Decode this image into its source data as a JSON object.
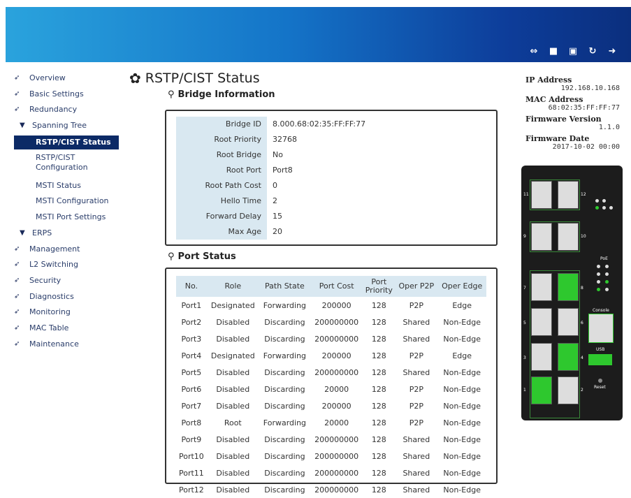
{
  "toolbar": {
    "icons": [
      "link-icon",
      "save-icon",
      "save-as-icon",
      "refresh-icon",
      "logout-icon"
    ]
  },
  "sidebar": {
    "items": [
      {
        "label": "Overview"
      },
      {
        "label": "Basic Settings"
      },
      {
        "label": "Redundancy"
      },
      {
        "label": "Spanning Tree"
      },
      {
        "label": "RSTP/CIST Status"
      },
      {
        "label": "RSTP/CIST Configuration"
      },
      {
        "label": "MSTI Status"
      },
      {
        "label": "MSTI Configuration"
      },
      {
        "label": "MSTI Port Settings"
      },
      {
        "label": "ERPS"
      },
      {
        "label": "Management"
      },
      {
        "label": "L2 Switching"
      },
      {
        "label": "Security"
      },
      {
        "label": "Diagnostics"
      },
      {
        "label": "Monitoring"
      },
      {
        "label": "MAC Table"
      },
      {
        "label": "Maintenance"
      }
    ]
  },
  "page": {
    "title": "RSTP/CIST Status"
  },
  "bridge": {
    "heading": "Bridge Information",
    "rows": [
      {
        "label": "Bridge ID",
        "value": "8.000.68:02:35:FF:FF:77"
      },
      {
        "label": "Root Priority",
        "value": "32768"
      },
      {
        "label": "Root Bridge",
        "value": "No"
      },
      {
        "label": "Root Port",
        "value": "Port8"
      },
      {
        "label": "Root Path Cost",
        "value": "0"
      },
      {
        "label": "Hello Time",
        "value": "2"
      },
      {
        "label": "Forward Delay",
        "value": "15"
      },
      {
        "label": "Max Age",
        "value": "20"
      }
    ]
  },
  "ports": {
    "heading": "Port Status",
    "columns": [
      "No.",
      "Role",
      "Path State",
      "Port Cost",
      "Port Priority",
      "Oper P2P",
      "Oper Edge"
    ],
    "rows": [
      [
        "Port1",
        "Designated",
        "Forwarding",
        "200000",
        "128",
        "P2P",
        "Edge"
      ],
      [
        "Port2",
        "Disabled",
        "Discarding",
        "200000000",
        "128",
        "Shared",
        "Non-Edge"
      ],
      [
        "Port3",
        "Disabled",
        "Discarding",
        "200000000",
        "128",
        "Shared",
        "Non-Edge"
      ],
      [
        "Port4",
        "Designated",
        "Forwarding",
        "200000",
        "128",
        "P2P",
        "Edge"
      ],
      [
        "Port5",
        "Disabled",
        "Discarding",
        "200000000",
        "128",
        "Shared",
        "Non-Edge"
      ],
      [
        "Port6",
        "Disabled",
        "Discarding",
        "20000",
        "128",
        "P2P",
        "Non-Edge"
      ],
      [
        "Port7",
        "Disabled",
        "Discarding",
        "200000",
        "128",
        "P2P",
        "Non-Edge"
      ],
      [
        "Port8",
        "Root",
        "Forwarding",
        "20000",
        "128",
        "P2P",
        "Non-Edge"
      ],
      [
        "Port9",
        "Disabled",
        "Discarding",
        "200000000",
        "128",
        "Shared",
        "Non-Edge"
      ],
      [
        "Port10",
        "Disabled",
        "Discarding",
        "200000000",
        "128",
        "Shared",
        "Non-Edge"
      ],
      [
        "Port11",
        "Disabled",
        "Discarding",
        "200000000",
        "128",
        "Shared",
        "Non-Edge"
      ],
      [
        "Port12",
        "Disabled",
        "Discarding",
        "200000000",
        "128",
        "Shared",
        "Non-Edge"
      ]
    ]
  },
  "info": {
    "ip_label": "IP Address",
    "ip": "192.168.10.168",
    "mac_label": "MAC Address",
    "mac": "68:02:35:FF:FF:77",
    "fw_label": "Firmware Version",
    "fw": "1.1.0",
    "date_label": "Firmware Date",
    "date": "2017-10-02 00:00"
  },
  "device": {
    "labels": {
      "p11": "11",
      "p12": "12",
      "p9": "9",
      "p10": "10",
      "p7": "7",
      "p8": "8",
      "p5": "5",
      "p6": "6",
      "p3": "3",
      "p4": "4",
      "p1": "1",
      "p2": "2",
      "poe": "PoE",
      "console": "Console",
      "usb": "USB",
      "reset": "Reset"
    },
    "link_up_ports": [
      1,
      4,
      8
    ]
  },
  "colors": {
    "nav_active": "#0c2a66",
    "table_header": "#d9e8f1",
    "port_link": "#2ec82e"
  }
}
